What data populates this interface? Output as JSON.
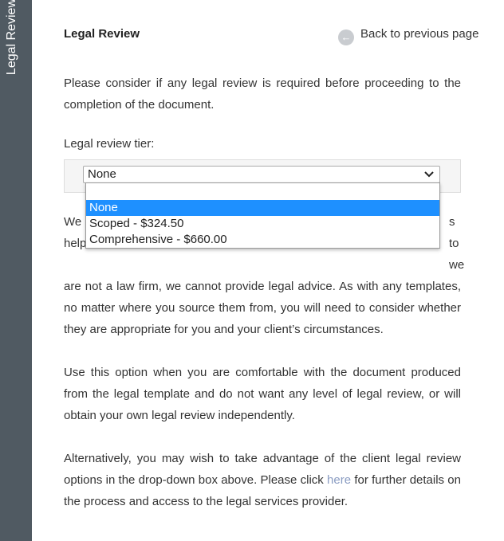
{
  "sidebar": {
    "label": "Legal Review"
  },
  "header": {
    "title": "Legal Review",
    "back_label": "Back to previous page"
  },
  "intro": "Please consider if any legal review is required before proceeding to the completion of the document.",
  "tier": {
    "label": "Legal review tier:",
    "selected": "None",
    "options": [
      "None",
      "Scoped - $324.50",
      "Comprehensive - $660.00"
    ]
  },
  "partial_line1": {
    "start": "We",
    "end": "s to"
  },
  "partial_line2": {
    "start": "help",
    "end": "we"
  },
  "disclaimer_rest": "are not a law firm, we cannot provide legal advice. As with any templates, no matter where you source them from, you will need to consider whether they are appropriate for you and your client’s circumstances.",
  "none_option_text": "Use this option when you are comfortable with the document produced from the legal template and do not want any level of legal review, or will obtain your own legal review independently.",
  "alt_text": {
    "before": "Alternatively, you may wish to take advantage of the client legal review options in the drop-down box above. Please click ",
    "link": "here",
    "after": " for further details on the process and access to the legal services provider."
  },
  "colors": {
    "sidebar": "#505a62",
    "selected_option": "#1e90ff",
    "link": "#8a9cc2"
  }
}
